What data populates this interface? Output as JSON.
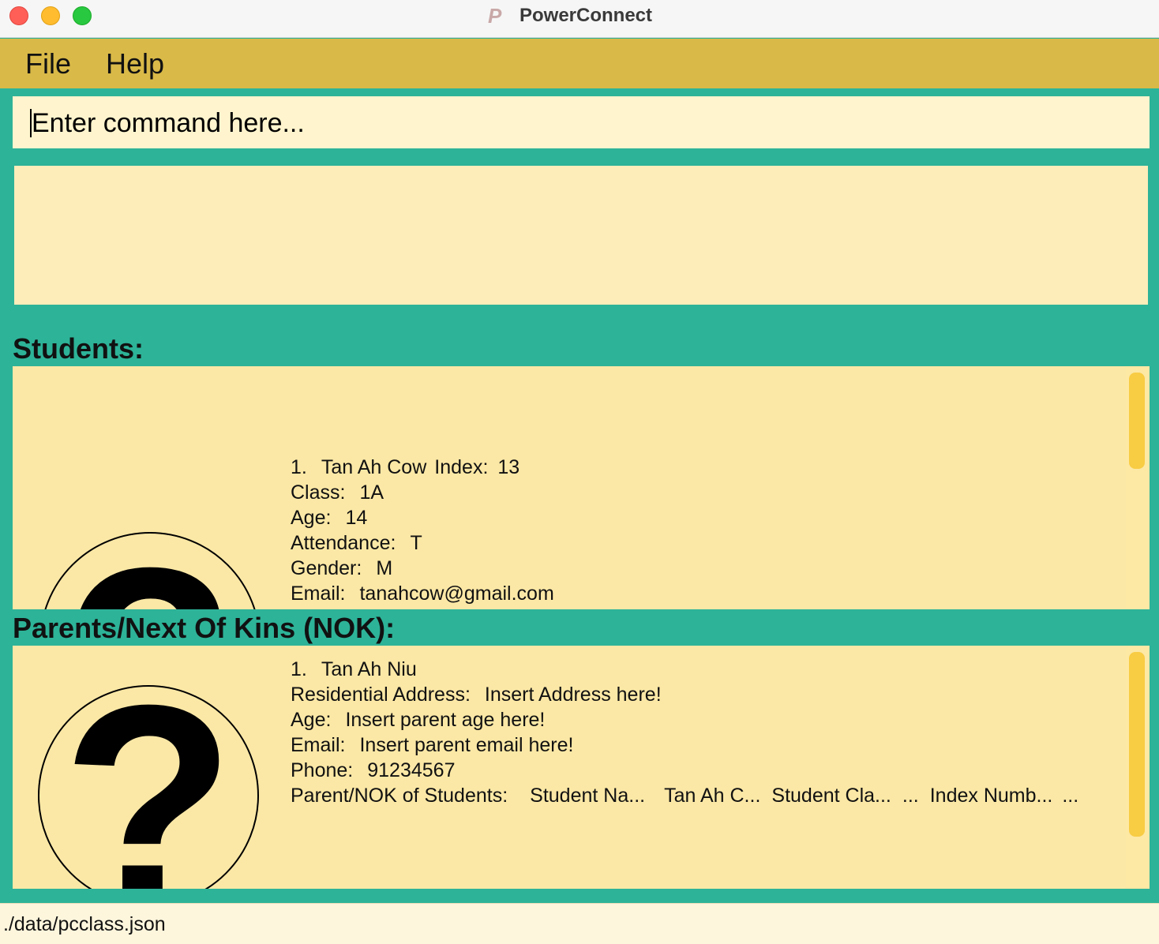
{
  "window": {
    "title": "PowerConnect",
    "logo_letter": "P"
  },
  "menu": {
    "file": "File",
    "help": "Help"
  },
  "command": {
    "placeholder": "Enter command here..."
  },
  "result": {
    "text": ""
  },
  "students": {
    "heading": "Students:",
    "avatar_glyph": "?",
    "card": {
      "index": "1.",
      "name": "Tan Ah Cow",
      "index_label": "Index:",
      "index_value": "13",
      "class_label": "Class:",
      "class_value": "1A",
      "age_label": "Age:",
      "age_value": "14",
      "attendance_label": "Attendance:",
      "attendance_value": "T",
      "gender_label": "Gender:",
      "gender_value": "M",
      "email_label": "Email:",
      "email_value": "tanahcow@gmail.com"
    }
  },
  "parents": {
    "heading": "Parents/Next Of Kins (NOK):",
    "avatar_glyph": "?",
    "card": {
      "index": "1.",
      "name": "Tan Ah Niu",
      "address_label": "Residential Address:",
      "address_value": "Insert Address here!",
      "age_label": "Age:",
      "age_value": "Insert parent age here!",
      "email_label": "Email:",
      "email_value": "Insert parent email here!",
      "phone_label": "Phone:",
      "phone_value": "91234567",
      "students_label": "Parent/NOK of Students:",
      "students_cells": [
        "Student Na...",
        "Tan Ah C...",
        "Student Cla...",
        "...",
        "Index Numb...",
        "..."
      ]
    }
  },
  "status": {
    "path": "./data/pcclass.json"
  },
  "colors": {
    "background": "#2db398",
    "menubar": "#d9b948",
    "panel": "#fbe8a6",
    "command": "#fff4cd",
    "scrollbar": "#f8cc43"
  }
}
